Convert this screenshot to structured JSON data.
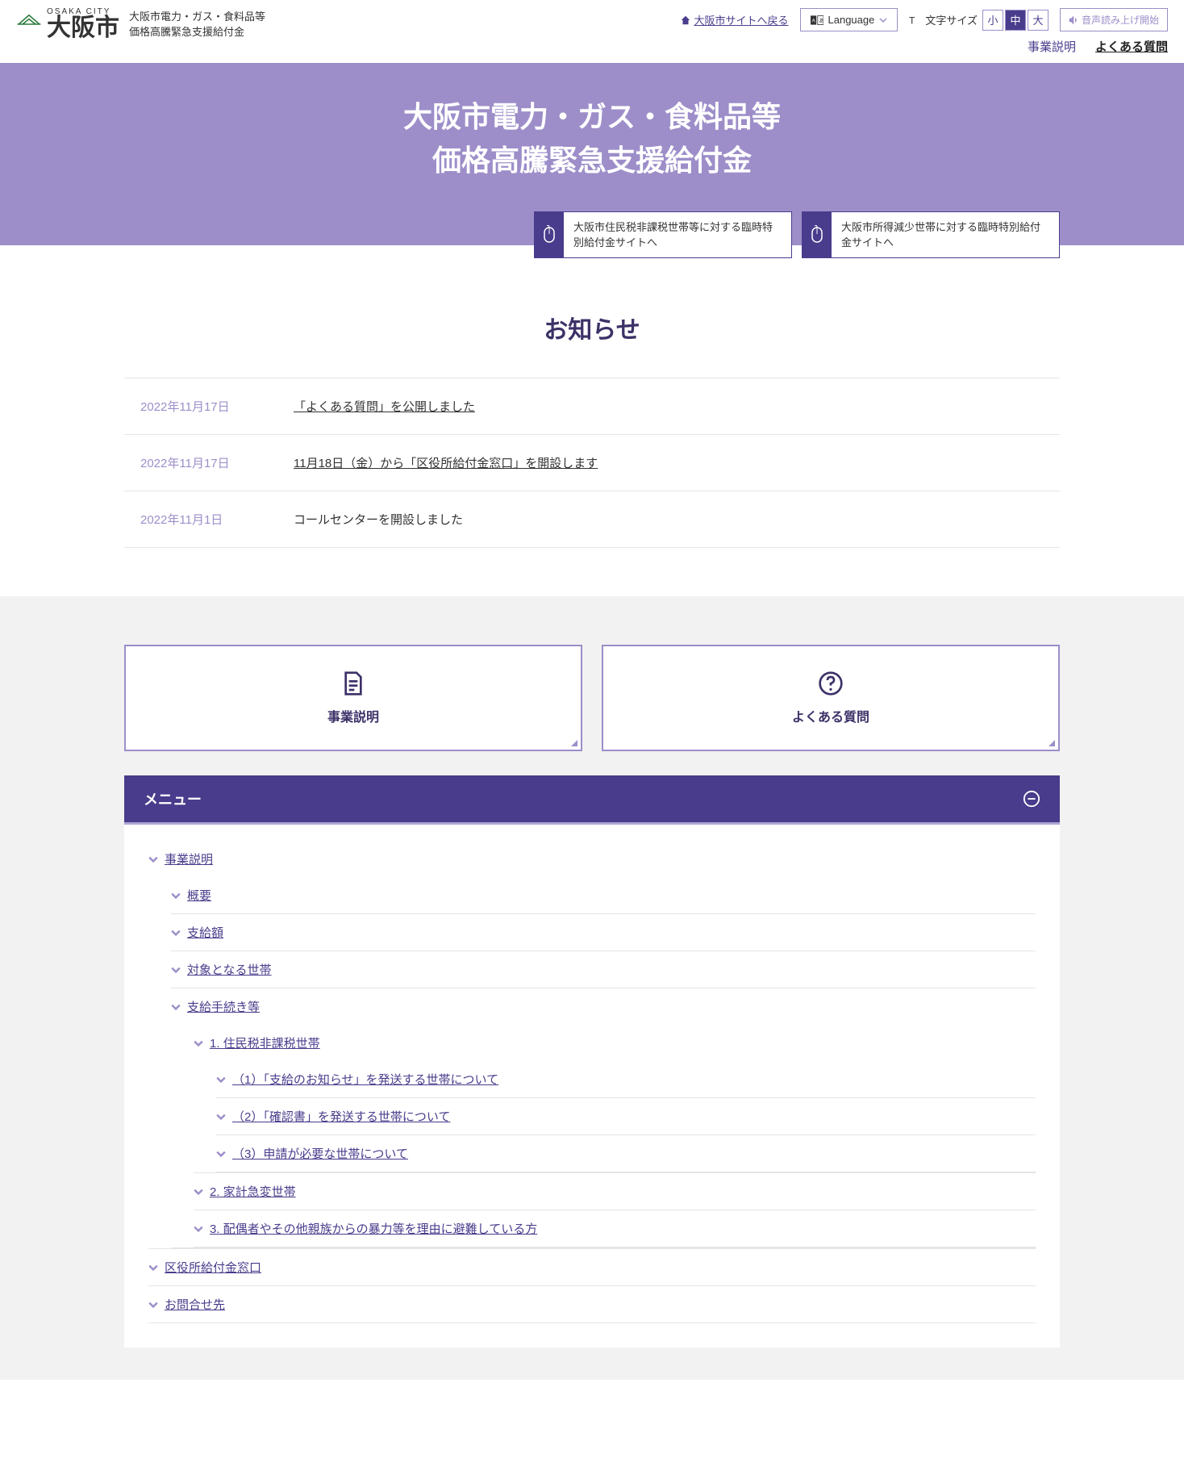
{
  "header": {
    "logo_sub": "OSAKA CITY",
    "logo_main": "大阪市",
    "site_title_line1": "大阪市電力・ガス・食料品等",
    "site_title_line2": "価格高騰緊急支援給付金",
    "back_link": "大阪市サイトへ戻る",
    "language": "Language",
    "textsize_label": "文字サイズ",
    "size_small": "小",
    "size_medium": "中",
    "size_large": "大",
    "tts": "音声読み上げ開始",
    "nav_business": "事業説明",
    "nav_faq": "よくある質問"
  },
  "hero": {
    "title_line1": "大阪市電力・ガス・食料品等",
    "title_line2": "価格高騰緊急支援給付金",
    "link1": "大阪市住民税非課税世帯等に対する臨時特別給付金サイトへ",
    "link2": "大阪市所得減少世帯に対する臨時特別給付金サイトへ"
  },
  "news": {
    "title": "お知らせ",
    "items": [
      {
        "date": "2022年11月17日",
        "text": "「よくある質問」を公開しました",
        "linked": true
      },
      {
        "date": "2022年11月17日",
        "text": "11月18日（金）から「区役所給付金窓口」を開設します",
        "linked": true
      },
      {
        "date": "2022年11月1日",
        "text": "コールセンターを開設しました",
        "linked": false
      }
    ]
  },
  "cards": {
    "business": "事業説明",
    "faq": "よくある質問"
  },
  "menu": {
    "title": "メニュー",
    "items": {
      "business": "事業説明",
      "overview": "概要",
      "amount": "支給額",
      "target": "対象となる世帯",
      "procedure": "支給手続き等",
      "proc1": "1. 住民税非課税世帯",
      "proc1_1": "（1）「支給のお知らせ」を発送する世帯について",
      "proc1_2": "（2）「確認書」を発送する世帯について",
      "proc1_3": "（3）申請が必要な世帯について",
      "proc2": "2. 家計急変世帯",
      "proc3": "3. 配偶者やその他親族からの暴力等を理由に避難している方",
      "ward": "区役所給付金窓口",
      "contact": "お問合せ先"
    }
  }
}
